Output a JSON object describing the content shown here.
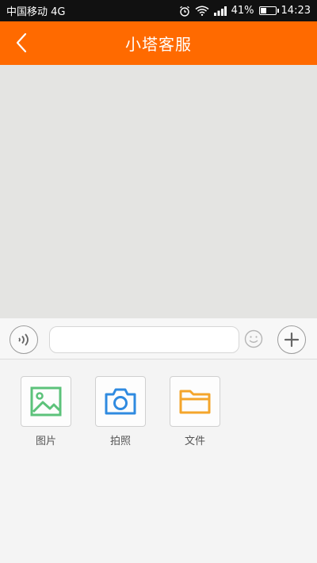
{
  "status_bar": {
    "carrier": "中国移动 4G",
    "battery_percent": "41%",
    "battery_level": 0.41,
    "time": "14:23"
  },
  "header": {
    "title": "小塔客服",
    "background": "#ff6a00"
  },
  "input_bar": {
    "text_value": "",
    "placeholder": ""
  },
  "attach_panel": {
    "items": [
      {
        "label": "图片",
        "icon": "image-icon",
        "color": "#5cc27a"
      },
      {
        "label": "拍照",
        "icon": "camera-icon",
        "color": "#2f8ae0"
      },
      {
        "label": "文件",
        "icon": "folder-icon",
        "color": "#f4a52b"
      }
    ]
  }
}
